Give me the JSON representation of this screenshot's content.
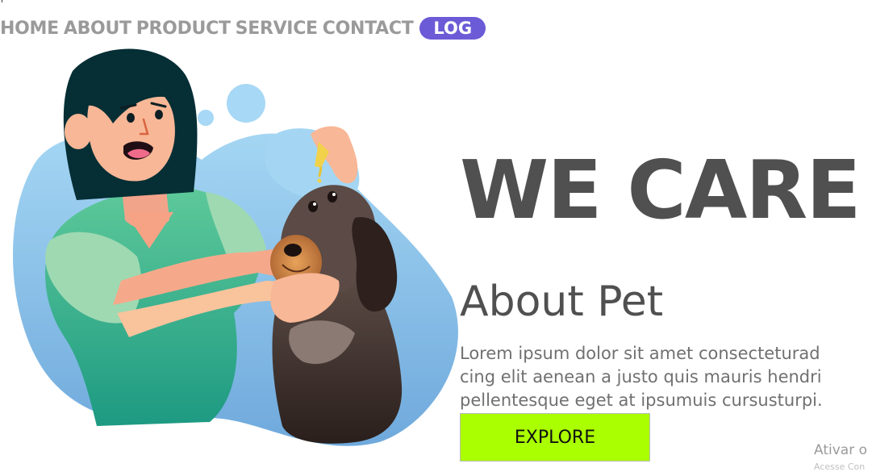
{
  "nav": {
    "links": [
      "HOME",
      "ABOUT",
      "PRODUCT",
      "SERVICE",
      "CONTACT"
    ],
    "login_label": "LOG"
  },
  "hero": {
    "headline": "WE CARE",
    "subheadline": "About Pet",
    "body_lines": [
      "Lorem ipsum dolor sit amet consecteturad",
      "cing elit aenean a justo quis mauris hendri",
      "pellentesque eget at ipsumuis cursusturpi."
    ],
    "cta_label": "EXPLORE"
  },
  "overlay": {
    "activation_text": "Ativar o",
    "activation_subtext": "Acesse Con"
  },
  "colors": {
    "nav_link": "#9a9a9a",
    "login_bg": "#6b5bd6",
    "heading": "#505050",
    "cta_bg": "#aaff00",
    "blob": "#8ec6ec"
  },
  "icons": {
    "illustration": "woman-giving-dog-eye-drops-illustration"
  }
}
